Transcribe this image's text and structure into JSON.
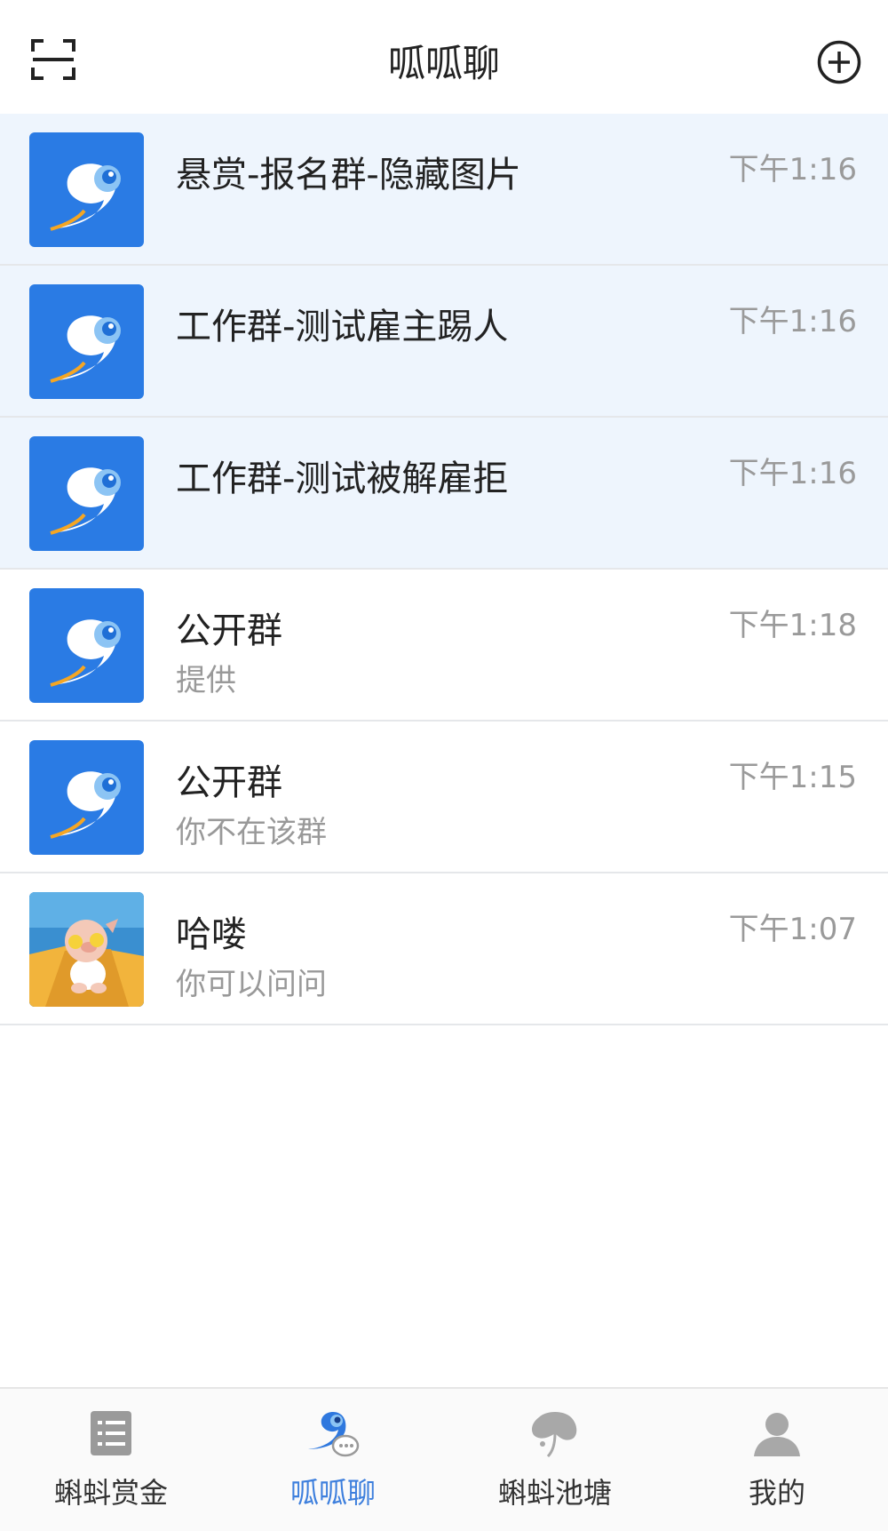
{
  "header": {
    "title": "呱呱聊"
  },
  "chats": [
    {
      "name": "悬赏-报名群-隐藏图片",
      "preview": "",
      "time": "下午1:16",
      "pinned": true,
      "avatar": "app-logo"
    },
    {
      "name": "工作群-测试雇主踢人",
      "preview": "",
      "time": "下午1:16",
      "pinned": true,
      "avatar": "app-logo"
    },
    {
      "name": "工作群-测试被解雇拒",
      "preview": "",
      "time": "下午1:16",
      "pinned": true,
      "avatar": "app-logo"
    },
    {
      "name": "公开群",
      "preview": "提供",
      "time": "下午1:18",
      "pinned": false,
      "avatar": "app-logo"
    },
    {
      "name": "公开群",
      "preview": "你不在该群",
      "time": "下午1:15",
      "pinned": false,
      "avatar": "app-logo"
    },
    {
      "name": "哈喽",
      "preview": "你可以问问",
      "time": "下午1:07",
      "pinned": false,
      "avatar": "pig-photo"
    }
  ],
  "tabs": [
    {
      "label": "蝌蚪赏金",
      "icon": "list-icon",
      "active": false
    },
    {
      "label": "呱呱聊",
      "icon": "chat-tadpole-icon",
      "active": true
    },
    {
      "label": "蝌蚪池塘",
      "icon": "lotus-leaf-icon",
      "active": false
    },
    {
      "label": "我的",
      "icon": "person-icon",
      "active": false
    }
  ],
  "colors": {
    "accent": "#3d7fdd",
    "avatar_blue": "#2a7be4",
    "pinned_bg": "#eef5fd"
  }
}
